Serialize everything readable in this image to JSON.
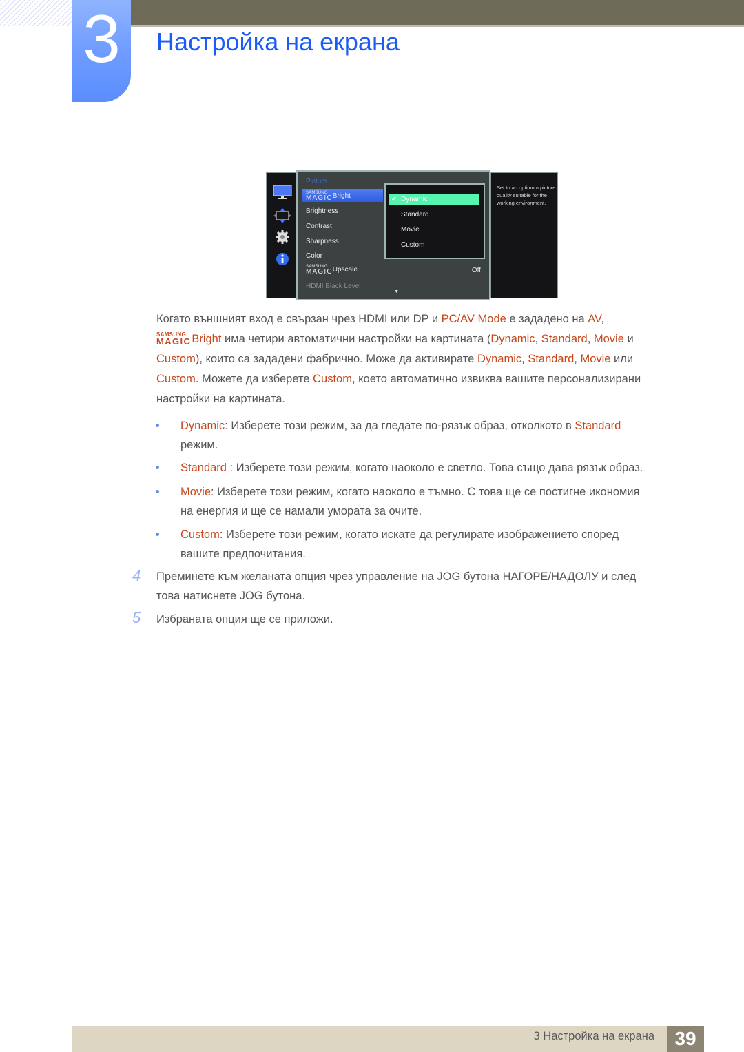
{
  "header": {
    "chapter_number": "3",
    "chapter_title": "Настройка на екрана"
  },
  "osd": {
    "side_icons": [
      "monitor-icon",
      "resize-icon",
      "gear-icon",
      "info-icon"
    ],
    "menu_title": "Picture",
    "magic_brand_top": "SAMSUNG",
    "magic_brand_bottom": "MAGIC",
    "items": [
      {
        "label": "Bright",
        "magic": true,
        "selected": true
      },
      {
        "label": "Brightness"
      },
      {
        "label": "Contrast"
      },
      {
        "label": "Sharpness"
      },
      {
        "label": "Color"
      },
      {
        "label": "Upscale",
        "magic": true,
        "value": "Off"
      },
      {
        "label": "HDMI Black Level",
        "dimmed": true
      }
    ],
    "upscale_value": "Off",
    "submenu": {
      "options": [
        "Dynamic",
        "Standard",
        "Movie",
        "Custom"
      ],
      "selected": "Dynamic",
      "check_glyph": "✓"
    },
    "help_text": "Set to an optimum picture quality suitable for the working environment.",
    "scroll_arrow": "▼",
    "colors": {
      "selected_item": "#3f6de8",
      "selected_option": "#55f5b0",
      "title": "#4a74e0"
    }
  },
  "body": {
    "intro_1a": "Когато външният вход е свързан чрез HDMI или DP и ",
    "intro_1b": "PC/AV Mode",
    "intro_1c": " е зададено на ",
    "intro_1d": "AV",
    "intro_1e": ",",
    "magic_top": "SAMSUNG",
    "magic_bottom": "MAGIC",
    "bright": "Bright",
    "intro_2a": " има четири автоматични настройки на картината (",
    "dynamic": "Dynamic",
    "standard": "Standard",
    "movie": "Movie",
    "custom": "Custom",
    "comma": ", ",
    "and": " и",
    "intro_3a": "), които са зададени фабрично. Може да активирате ",
    "or": " или",
    "intro_4a": ". Можете да изберете ",
    "intro_4b": ", което автоматично извиква вашите персонализирани",
    "intro_5": "настройки на картината.",
    "bullets": [
      {
        "term": "Dynamic",
        "text": ": Изберете този режим, за да гледате по-рязък образ, отколкото в ",
        "term2": "Standard",
        "text2": "режим."
      },
      {
        "term": "Standard",
        "text": " : Изберете този режим, когато наоколо е светло. Това също дава рязък образ."
      },
      {
        "term": "Movie",
        "text": ": Изберете този режим, когато наоколо е тъмно. С това ще се постигне икономия",
        "text2": "на енергия и ще се намали умората за очите."
      },
      {
        "term": "Custom",
        "text": ": Изберете този режим, когато искате да регулирате изображението според",
        "text2": "вашите предпочитания."
      }
    ],
    "steps": [
      {
        "num": "4",
        "line1": "Преминете към желаната опция чрез управление на JOG бутона НАГОРЕ/НАДОЛУ и след",
        "line2": "това натиснете JOG бутона."
      },
      {
        "num": "5",
        "line1": "Избраната опция ще се приложи."
      }
    ],
    "highlight_color": "#c8461a"
  },
  "footer": {
    "label": "3 Настройка на екрана",
    "page_number": "39"
  }
}
